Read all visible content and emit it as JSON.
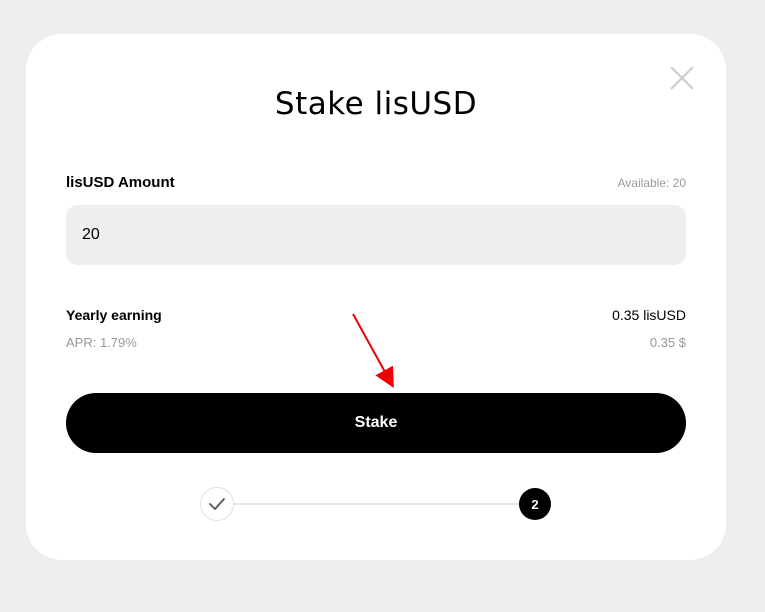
{
  "modal": {
    "title": "Stake lisUSD",
    "close_icon": "close-icon"
  },
  "amount": {
    "label": "lisUSD Amount",
    "available": "Available: 20",
    "value": "20"
  },
  "earnings": {
    "label": "Yearly earning",
    "value": "0.35 lisUSD",
    "apr": "APR: 1.79%",
    "usd": "0.35 $"
  },
  "actions": {
    "stake_label": "Stake"
  },
  "stepper": {
    "completed_icon": "checkmark-icon",
    "current_step": "2"
  },
  "annotation": {
    "arrow_color": "#ee0000"
  }
}
